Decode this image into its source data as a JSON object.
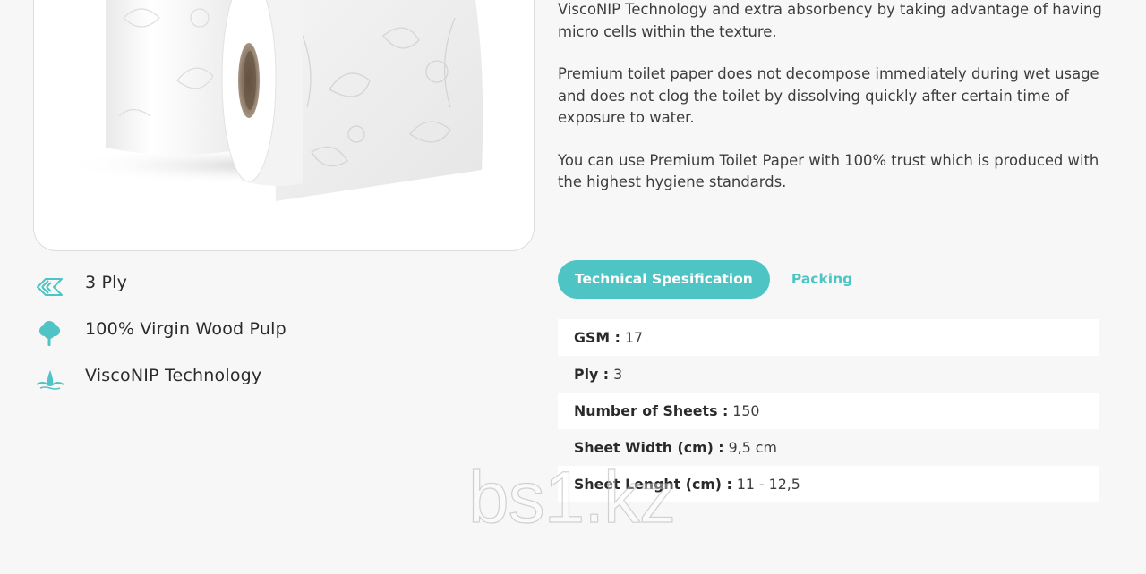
{
  "description": {
    "paragraphs": [
      "ViscoNIP Technology and extra absorbency by taking advantage of having micro cells within the texture.",
      "Premium toilet paper does not decompose immediately during wet usage and does not clog the toilet by dissolving quickly after certain time of exposure to water.",
      "You can use Premium Toilet Paper with 100% trust which is produced with the highest hygiene standards."
    ]
  },
  "features": [
    {
      "icon": "layers-icon",
      "label": "3 Ply"
    },
    {
      "icon": "tree-icon",
      "label": "100% Virgin Wood Pulp"
    },
    {
      "icon": "water-drop-icon",
      "label": "ViscoNIP Technology"
    }
  ],
  "tabs": {
    "technical": "Technical Spesification",
    "packing": "Packing"
  },
  "specs": [
    {
      "key": "GSM :",
      "value": "17"
    },
    {
      "key": "Ply :",
      "value": "3"
    },
    {
      "key": "Number of Sheets :",
      "value": "150"
    },
    {
      "key": "Sheet Width (cm) :",
      "value": "9,5 cm"
    },
    {
      "key": "Sheet Lenght (cm) :",
      "value": "11 - 12,5"
    }
  ],
  "watermark": "bs1.kz",
  "colors": {
    "accent": "#4fc4c4",
    "background": "#f7f7f7"
  }
}
